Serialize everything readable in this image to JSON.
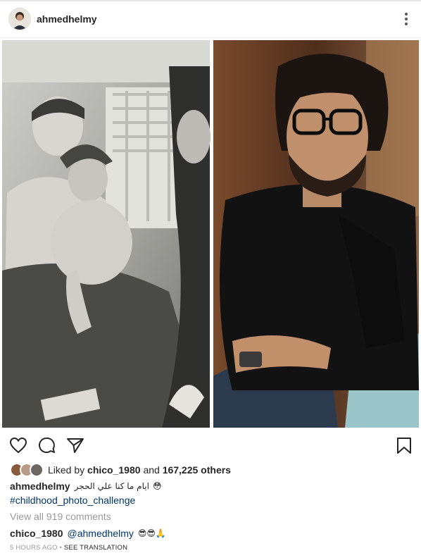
{
  "post": {
    "username": "ahmedhelmy",
    "liked_by_prefix": "Liked by",
    "liked_by_user": "chico_1980",
    "liked_and": "and",
    "likes_count": "167,225 others",
    "caption_user": "ahmedhelmy",
    "caption_text": "ايام ما كنا علي الحجر",
    "caption_emoji": "😳",
    "hashtag": "#childhood_photo_challenge",
    "view_comments": "View all 919 comments",
    "comment_user": "chico_1980",
    "comment_mention": "@ahmedhelmy",
    "comment_emoji": "😎😎🙏",
    "time_ago": "5 HOURS AGO",
    "dot": "•",
    "see_translation": "SEE TRANSLATION"
  },
  "icons": [
    "more-icon",
    "heart-icon",
    "comment-icon",
    "share-icon",
    "bookmark-icon"
  ],
  "colors": {
    "link": "#003569",
    "muted": "#999999",
    "text": "#262626"
  }
}
